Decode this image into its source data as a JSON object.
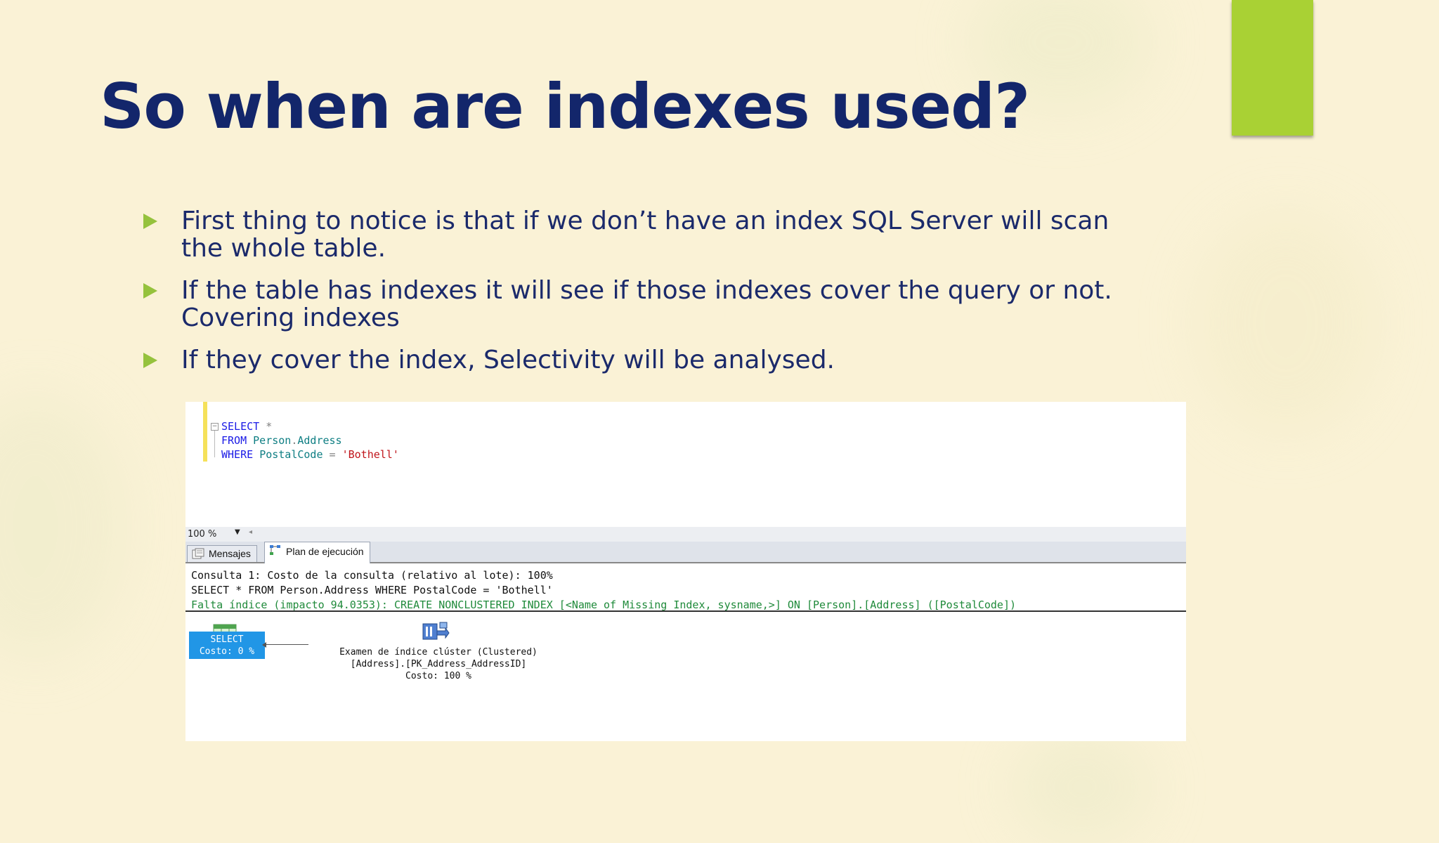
{
  "slide": {
    "title": "So when are indexes used?",
    "bullets": [
      "First thing to notice is that if we don’t have an index SQL Server will scan the whole table.",
      "If the table has indexes it will see if those indexes cover the query or not. Covering indexes",
      "If they cover the index, Selectivity will be analysed."
    ],
    "colors": {
      "title": "#13266b",
      "accent": "#a9d134",
      "bullet_arrow": "#95c23d",
      "background": "#faf2d6"
    }
  },
  "editor": {
    "line1_kw": "SELECT",
    "line1_rest": " *",
    "line2_kw": "FROM",
    "line2_schema": "Person",
    "line2_dot": ".",
    "line2_table": "Address",
    "line3_kw": "WHERE",
    "line3_col": "PostalCode",
    "line3_op": " = ",
    "line3_str": "'Bothell'",
    "zoom": "100 %"
  },
  "tabs": [
    {
      "label": "Mensajes",
      "icon": "messages-icon"
    },
    {
      "label": "Plan de ejecución",
      "icon": "execution-plan-icon"
    }
  ],
  "results": {
    "line1": "Consulta 1: Costo de la consulta (relativo al lote): 100%",
    "line2": "SELECT * FROM Person.Address WHERE PostalCode = 'Bothell'",
    "line3": "Falta índice (impacto 94.0353): CREATE NONCLUSTERED INDEX [<Name of Missing Index, sysname,>] ON [Person].[Address] ([PostalCode])",
    "select_node": {
      "label": "SELECT",
      "cost": "Costo: 0 %"
    },
    "scan_node": {
      "line1": "Examen de índice clúster (Clustered)",
      "line2": "[Address].[PK_Address_AddressID]",
      "line3": "Costo: 100 %"
    }
  }
}
